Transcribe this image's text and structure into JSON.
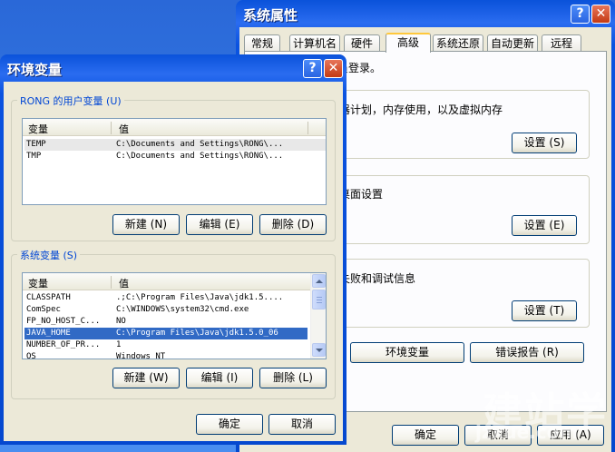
{
  "sysprops": {
    "title": "系统属性",
    "tabs": [
      "常规",
      "计算机名",
      "硬件",
      "高级",
      "系统还原",
      "自动更新",
      "远程"
    ],
    "admin_note": "，您必须作为管理员登录。",
    "perf_text": "视觉效果，处理器计划，内存使用，以及虚拟内存",
    "profile_text": "与您登录有关的桌面设置",
    "startup_text": "系统启动，系统失败和调试信息",
    "settings_label": "设置 (S)",
    "settings_label_2": "设置 (E)",
    "settings_label_3": "设置 (T)",
    "env_vars_button": "环境变量",
    "error_report_button": "错误报告 (R)",
    "ok": "确定",
    "cancel": "取消",
    "apply": "应用 (A)"
  },
  "env": {
    "title": "环境变量",
    "user_group_title": "RONG 的用户变量 (U)",
    "col_var": "变量",
    "col_val": "值",
    "user_vars": [
      {
        "name": "TEMP",
        "value": "C:\\Documents and Settings\\RONG\\..."
      },
      {
        "name": "TMP",
        "value": "C:\\Documents and Settings\\RONG\\..."
      }
    ],
    "user_new": "新建 (N)",
    "user_edit": "编辑 (E)",
    "user_delete": "删除 (D)",
    "sys_group_title": "系统变量 (S)",
    "sys_vars": [
      {
        "name": "CLASSPATH",
        "value": ".;C:\\Program Files\\Java\\jdk1.5...."
      },
      {
        "name": "ComSpec",
        "value": "C:\\WINDOWS\\system32\\cmd.exe"
      },
      {
        "name": "FP_NO_HOST_C...",
        "value": "NO"
      },
      {
        "name": "JAVA_HOME",
        "value": "C:\\Program Files\\Java\\jdk1.5.0_06"
      },
      {
        "name": "NUMBER_OF_PR...",
        "value": "1"
      },
      {
        "name": "OS",
        "value": "Windows_NT"
      }
    ],
    "sys_new": "新建 (W)",
    "sys_edit": "编辑 (I)",
    "sys_delete": "删除 (L)",
    "ok": "确定",
    "cancel": "取消"
  },
  "watermark": {
    "logo": "建站学",
    "url": "jzxue.com"
  },
  "colors": {
    "selection": "#316ac5",
    "group_title": "#0046d5",
    "titlebar": "#0548cf"
  }
}
